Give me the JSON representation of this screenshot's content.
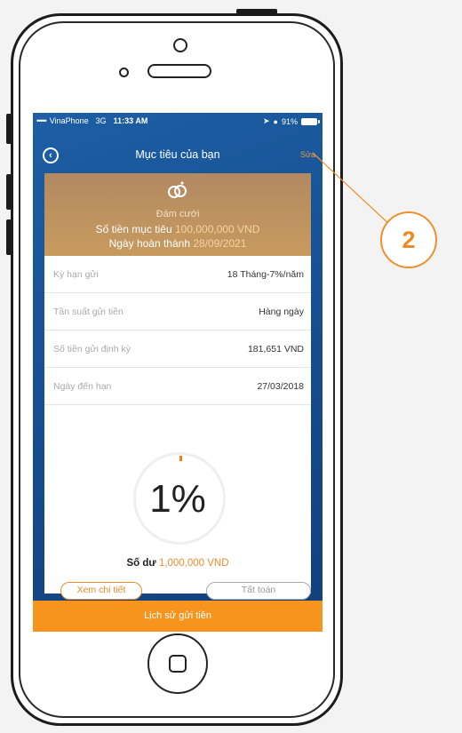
{
  "status_bar": {
    "dots": "•••••",
    "carrier": "VinaPhone",
    "network": "3G",
    "time": "11:33 AM",
    "battery": "91%"
  },
  "nav": {
    "title": "Mục tiêu của bạn",
    "edit_label": "Sửa",
    "back_icon": "back-arrow-circle-icon"
  },
  "goal": {
    "icon": "wedding-rings-icon",
    "name": "Đám cưới",
    "target_label": "Số tiền mục tiêu",
    "target_value": "100,000,000 VND",
    "date_label": "Ngày hoàn thành",
    "date_value": "28/09/2021"
  },
  "details": [
    {
      "label": "Kỳ hạn gửi",
      "value": "18 Tháng-7%/năm"
    },
    {
      "label": "Tần suất gửi tiền",
      "value": "Hàng ngày"
    },
    {
      "label": "Số tiền gửi định kỳ",
      "value": "181,651 VND"
    },
    {
      "label": "Ngày đến hạn",
      "value": "27/03/2018"
    }
  ],
  "progress": {
    "percent_text": "1%",
    "fraction": 0.01
  },
  "balance": {
    "label": "Số dư",
    "value": "1,000,000 VND"
  },
  "buttons": {
    "detail": "Xem chi tiết",
    "settle": "Tất toán",
    "history": "Lịch sử gửi tiền"
  },
  "callout": {
    "number": "2"
  },
  "colors": {
    "accent": "#f7941d",
    "screen_bg": "#1d5ea4",
    "goal_card": "#c79a5e"
  }
}
